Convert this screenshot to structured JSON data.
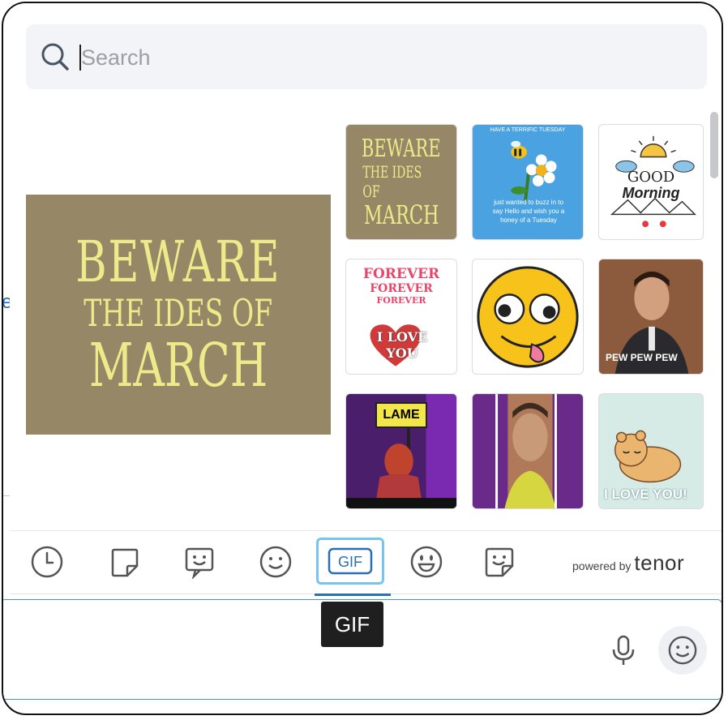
{
  "search": {
    "placeholder": "Search"
  },
  "featured": {
    "line1": "BEWARE",
    "line2": "THE IDES OF",
    "line3": "MARCH"
  },
  "tiles": [
    {
      "text1": "BEWARE",
      "text2": "THE IDES OF",
      "text3": "MARCH"
    },
    {
      "header": "HAVE A TERRIFIC TUESDAY",
      "body": "just wanted to buzz in to say Hello and wish you a honey of a Tuesday"
    },
    {
      "text1": "GOOD",
      "text2": "Morning"
    },
    {
      "text1": "FOREVER",
      "text2": "FOREVER",
      "text3": "FOREVER",
      "text4": "I LOVE YOU"
    },
    {
      "label": ""
    },
    {
      "caption": "PEW PEW PEW"
    },
    {
      "sign": "LAME"
    },
    {
      "label": ""
    },
    {
      "caption": "I LOVE YOU!"
    }
  ],
  "categories": [
    {
      "name": "recent-icon"
    },
    {
      "name": "sticker-icon"
    },
    {
      "name": "custom-emoji-icon"
    },
    {
      "name": "emoji-icon"
    },
    {
      "name": "gif-icon",
      "label": "GIF"
    },
    {
      "name": "animated-emoji-icon"
    },
    {
      "name": "custom-sticker-icon"
    }
  ],
  "powered_by": {
    "prefix": "powered by",
    "brand": "tenor"
  },
  "tooltip": "GIF",
  "colors": {
    "accent": "#2a6fb3",
    "gif_highlight": "#76c5ee"
  }
}
